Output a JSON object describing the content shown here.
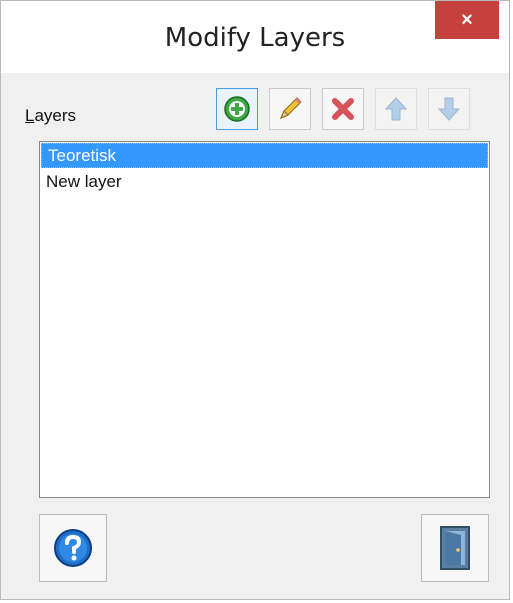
{
  "window": {
    "title": "Modify Layers",
    "close_glyph": "×"
  },
  "layers_label_accel": "L",
  "layers_label_rest": "ayers",
  "toolbar": {
    "add_icon": "add-layer-icon",
    "edit_icon": "edit-pencil-icon",
    "delete_icon": "delete-x-icon",
    "up_icon": "move-up-arrow-icon",
    "down_icon": "move-down-arrow-icon"
  },
  "layers": [
    {
      "label": "Teoretisk",
      "selected": true
    },
    {
      "label": "New layer",
      "selected": false
    }
  ],
  "footer": {
    "help_icon": "help-question-icon",
    "exit_icon": "exit-door-icon"
  },
  "colors": {
    "accent": "#3399ff",
    "close": "#c7413c"
  }
}
